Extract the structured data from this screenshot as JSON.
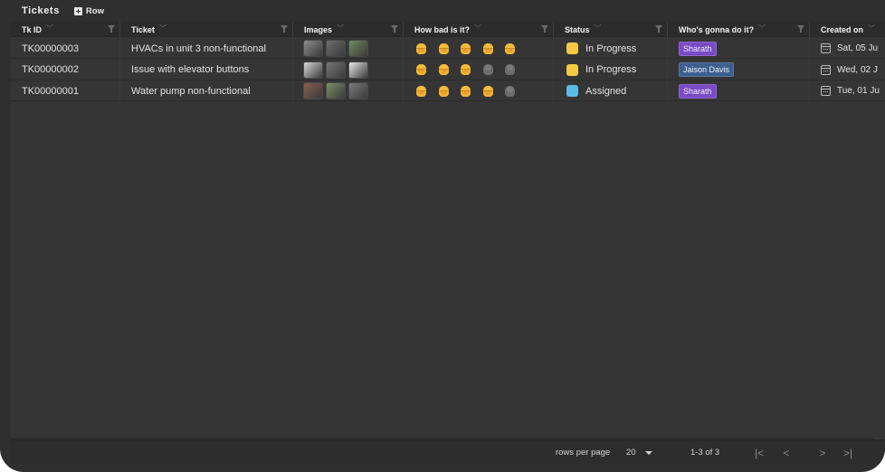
{
  "header": {
    "title": "Tickets",
    "add_row_label": "Row"
  },
  "columns": [
    {
      "label": "Tk ID"
    },
    {
      "label": "Ticket"
    },
    {
      "label": "Images"
    },
    {
      "label": "How bad is it?"
    },
    {
      "label": "Status"
    },
    {
      "label": "Who's gonna do it?"
    },
    {
      "label": "Created on"
    }
  ],
  "rows": [
    {
      "id": "TK00000003",
      "ticket": "HVACs in unit 3 non-functional",
      "severity": 5,
      "status": "In Progress",
      "status_color": "#f5c944",
      "assignee": "Sharath",
      "assignee_color": "#7a4bc7",
      "created": "Sat, 05 Ju",
      "images": [
        "#8c8c8c",
        "#6e6e6e",
        "#6f8a5e"
      ]
    },
    {
      "id": "TK00000002",
      "ticket": "Issue with elevator buttons",
      "severity": 3,
      "status": "In Progress",
      "status_color": "#f5c944",
      "assignee": "Jaison Davis",
      "assignee_color": "#3d5f8f",
      "created": "Wed, 02 J",
      "images": [
        "#d9d9d9",
        "#767676",
        "#e6e6e6"
      ]
    },
    {
      "id": "TK00000001",
      "ticket": "Water pump non-functional",
      "severity": 4,
      "status": "Assigned",
      "status_color": "#5bbbe6",
      "assignee": "Sharath",
      "assignee_color": "#7a4bc7",
      "created": "Tue, 01 Ju",
      "images": [
        "#8a5e4e",
        "#7c8f63",
        "#7a7a7a"
      ]
    }
  ],
  "severity_max": 5,
  "footer": {
    "rows_per_page_label": "rows per page",
    "rows_per_page_value": "20",
    "range": "1-3 of 3"
  }
}
